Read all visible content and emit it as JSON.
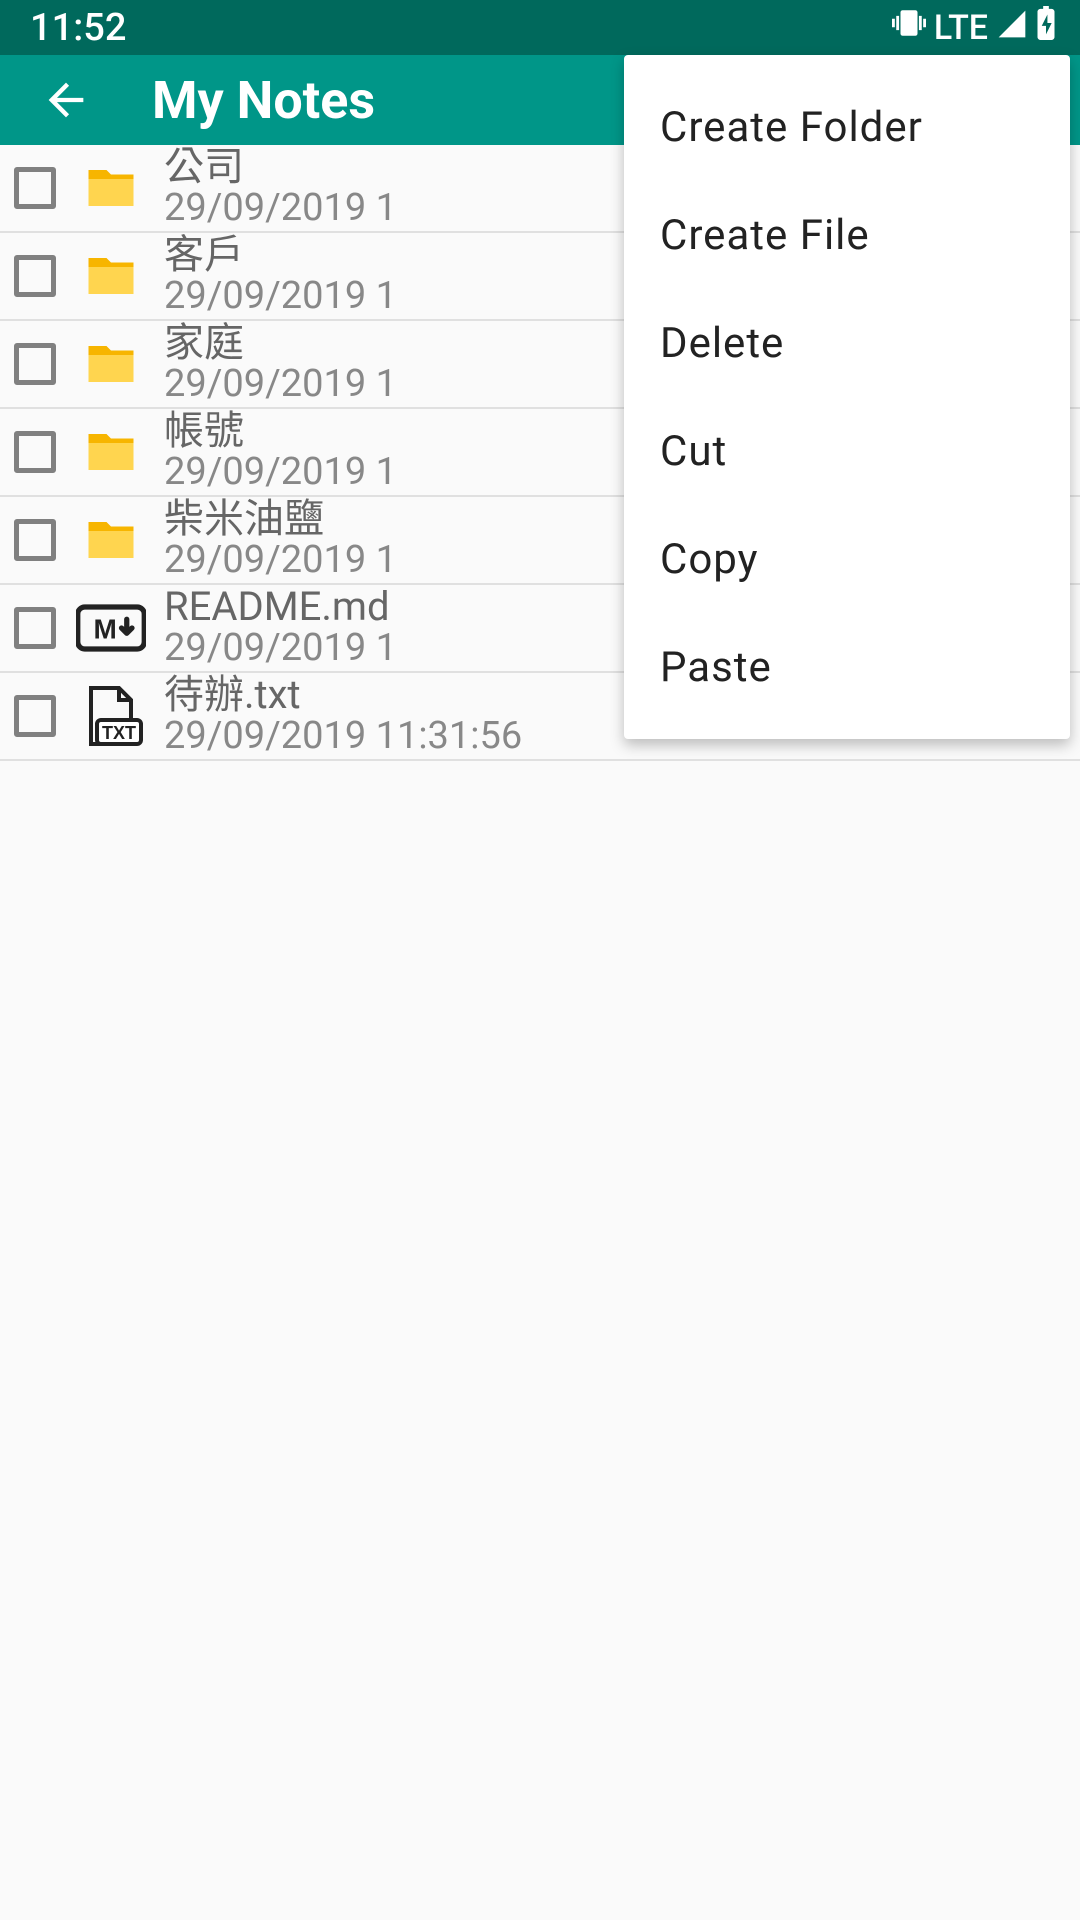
{
  "status": {
    "time": "11:52",
    "network": "LTE"
  },
  "app": {
    "title": "My Notes"
  },
  "files": [
    {
      "name": "公司",
      "date": "29/09/2019 1",
      "kind": "folder"
    },
    {
      "name": "客戶",
      "date": "29/09/2019 1",
      "kind": "folder"
    },
    {
      "name": "家庭",
      "date": "29/09/2019 1",
      "kind": "folder"
    },
    {
      "name": "帳號",
      "date": "29/09/2019 1",
      "kind": "folder"
    },
    {
      "name": "柴米油鹽",
      "date": "29/09/2019 1",
      "kind": "folder"
    },
    {
      "name": "README.md",
      "date": "29/09/2019 1",
      "kind": "md"
    },
    {
      "name": "待辦.txt",
      "date": "29/09/2019 11:31:56",
      "kind": "txt"
    }
  ],
  "menu": {
    "items": [
      "Create Folder",
      "Create File",
      "Delete",
      "Cut",
      "Copy",
      "Paste"
    ]
  }
}
